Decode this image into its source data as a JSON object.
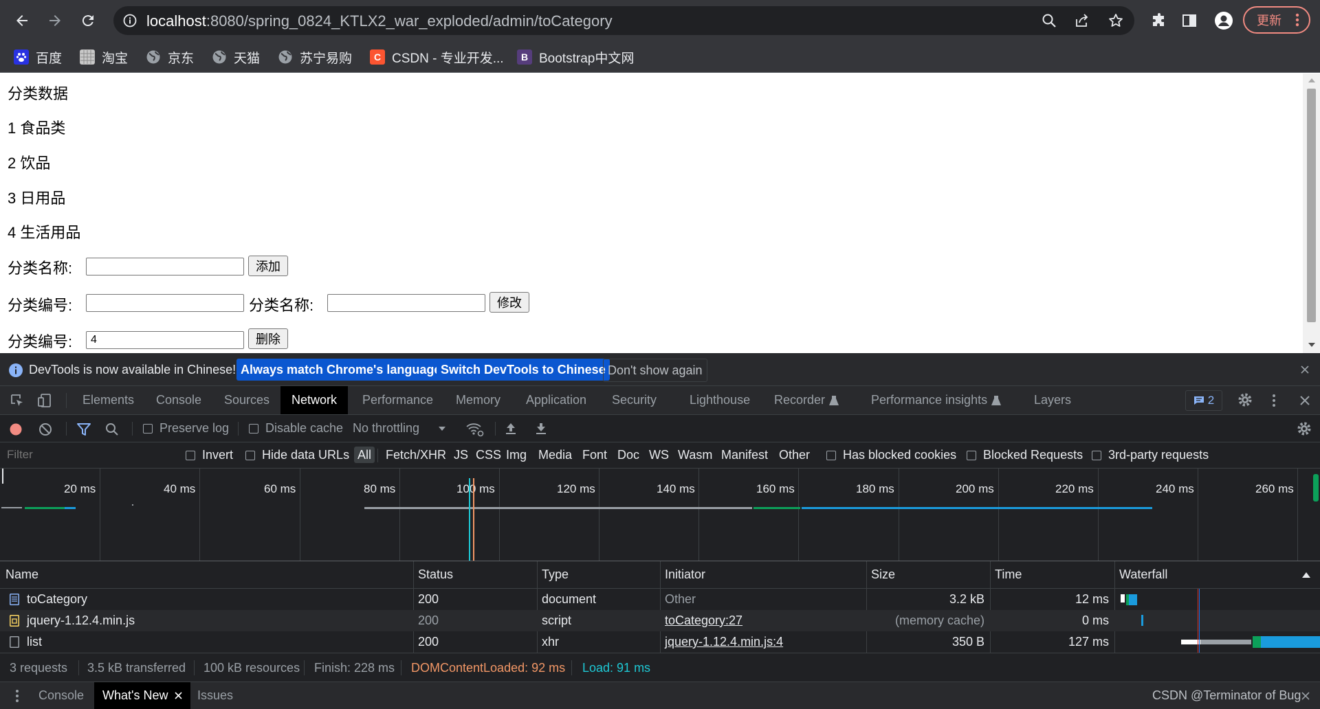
{
  "browser": {
    "url_host": "localhost",
    "url_path": ":8080/spring_0824_KTLX2_war_exploded/admin/toCategory",
    "update_label": "更新",
    "bookmarks": [
      {
        "label": "百度"
      },
      {
        "label": "淘宝"
      },
      {
        "label": "京东"
      },
      {
        "label": "天猫"
      },
      {
        "label": "苏宁易购"
      },
      {
        "label": "CSDN - 专业开发..."
      },
      {
        "label": "Bootstrap中文网"
      }
    ],
    "bookmark_icons": {
      "csdn": "C",
      "bootstrap": "B"
    }
  },
  "page": {
    "heading": "分类数据",
    "categories": [
      "1 食品类",
      "2 饮品",
      "3 日用品",
      "4 生活用品"
    ],
    "add_form": {
      "name_label": "分类名称:",
      "name_value": "",
      "button": "添加"
    },
    "edit_form": {
      "id_label": "分类编号:",
      "id_value": "",
      "name_label": "分类名称:",
      "name_value": "",
      "button": "修改"
    },
    "delete_form": {
      "id_label": "分类编号:",
      "id_value": "4",
      "button": "删除"
    }
  },
  "devtools": {
    "infobar": {
      "message": "DevTools is now available in Chinese!",
      "btn_match": "Always match Chrome's language",
      "btn_switch": "Switch DevTools to Chinese",
      "btn_dismiss": "Don't show again"
    },
    "tabs": [
      "Elements",
      "Console",
      "Sources",
      "Network",
      "Performance",
      "Memory",
      "Application",
      "Security",
      "Lighthouse",
      "Recorder",
      "Performance insights",
      "Layers"
    ],
    "issues_count": "2",
    "network_toolbar": {
      "preserve_log": "Preserve log",
      "disable_cache": "Disable cache",
      "throttling": "No throttling"
    },
    "filter": {
      "placeholder": "Filter",
      "invert": "Invert",
      "hide_data_urls": "Hide data URLs",
      "types": [
        "All",
        "Fetch/XHR",
        "JS",
        "CSS",
        "Img",
        "Media",
        "Font",
        "Doc",
        "WS",
        "Wasm",
        "Manifest",
        "Other"
      ],
      "has_blocked_cookies": "Has blocked cookies",
      "blocked_requests": "Blocked Requests",
      "third_party": "3rd-party requests"
    },
    "overview_ticks": [
      "20 ms",
      "40 ms",
      "60 ms",
      "80 ms",
      "100 ms",
      "120 ms",
      "140 ms",
      "160 ms",
      "180 ms",
      "200 ms",
      "220 ms",
      "240 ms",
      "260 ms"
    ],
    "columns": [
      "Name",
      "Status",
      "Type",
      "Initiator",
      "Size",
      "Time",
      "Waterfall"
    ],
    "requests": [
      {
        "name": "toCategory",
        "status": "200",
        "type": "document",
        "initiator": "Other",
        "size": "3.2 kB",
        "time": "12 ms"
      },
      {
        "name": "jquery-1.12.4.min.js",
        "status": "200",
        "type": "script",
        "initiator": "toCategory:27",
        "size": "(memory cache)",
        "time": "0 ms"
      },
      {
        "name": "list",
        "status": "200",
        "type": "xhr",
        "initiator": "jquery-1.12.4.min.js:4",
        "size": "350 B",
        "time": "127 ms"
      }
    ],
    "summary": {
      "requests": "3 requests",
      "transferred": "3.5 kB transferred",
      "resources": "100 kB resources",
      "finish": "Finish: 228 ms",
      "dcl": "DOMContentLoaded: 92 ms",
      "load": "Load: 91 ms"
    },
    "drawer_tabs": [
      "Console",
      "What's New",
      "Issues"
    ],
    "watermark": "CSDN @Terminator of Bug",
    "colors": {
      "dcl": "#f29766",
      "load": "#1ec8d4",
      "waterfall_blue": "#1a9bdd",
      "waterfall_green": "#0ca05a"
    }
  }
}
